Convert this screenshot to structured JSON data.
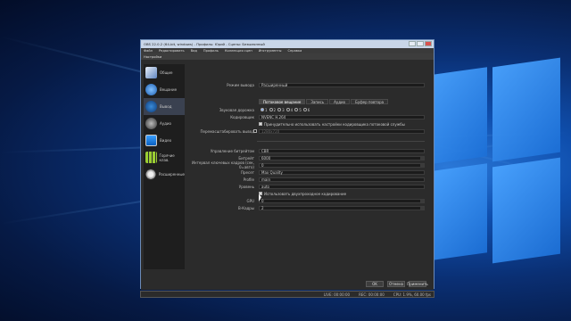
{
  "window": {
    "title": "OBS 22.0.2 (64-bit, windows) - Профиль: Юрий - Сцены: Безымянный"
  },
  "menu": [
    "Файл",
    "Редактировать",
    "Вид",
    "Профиль",
    "Коллекция сцен",
    "Инструменты",
    "Справка"
  ],
  "settings_title": "Настройки",
  "sidebar": [
    {
      "label": "Общие",
      "icon": "settings-icon"
    },
    {
      "label": "Вещание",
      "icon": "globe-icon"
    },
    {
      "label": "Вывод",
      "icon": "output-icon"
    },
    {
      "label": "Аудио",
      "icon": "audio-icon"
    },
    {
      "label": "Видео",
      "icon": "monitor-icon"
    },
    {
      "label": "Горячие клав.",
      "icon": "keyboard-icon"
    },
    {
      "label": "Расширенные",
      "icon": "gears-icon"
    }
  ],
  "output_mode": {
    "label": "Режим вывода",
    "value": "Расширенный"
  },
  "tabs": [
    "Потоковое вещание",
    "Запись",
    "Аудио",
    "Буфер повтора"
  ],
  "audio_track": {
    "label": "Звуковая дорожка",
    "options": [
      "1",
      "2",
      "3",
      "4",
      "5",
      "6"
    ],
    "selected": "1"
  },
  "encoder": {
    "label": "Кодировщик",
    "value": "NVENC H.264"
  },
  "enforce_settings": "Принудительно использовать настройки кодировщика потоковой службы",
  "rescale": {
    "label": "Перемасштабировать вывод",
    "value": "1280x720"
  },
  "rate_control": {
    "label": "Управление битрейтом",
    "value": "CBR"
  },
  "bitrate": {
    "label": "Битрейт",
    "value": "6000"
  },
  "keyframe": {
    "label": "Интервал ключевых кадров (сек, 0=авто)",
    "value": "0"
  },
  "preset": {
    "label": "Пресет",
    "value": "Max Quality"
  },
  "profile": {
    "label": "Profile",
    "value": "main"
  },
  "level": {
    "label": "Уровень",
    "value": "auto"
  },
  "two_pass": "Использовать двухпроходное кодирование",
  "gpu": {
    "label": "GPU",
    "value": "0"
  },
  "bframes": {
    "label": "B-Кадры",
    "value": "2"
  },
  "buttons": {
    "ok": "OK",
    "cancel": "Отмена",
    "apply": "Применить"
  },
  "status": {
    "live": "LIVE: 00:00:00",
    "rec": "REC: 00:00:00",
    "cpu": "CPU: 1.9%, 60.00 fps"
  }
}
